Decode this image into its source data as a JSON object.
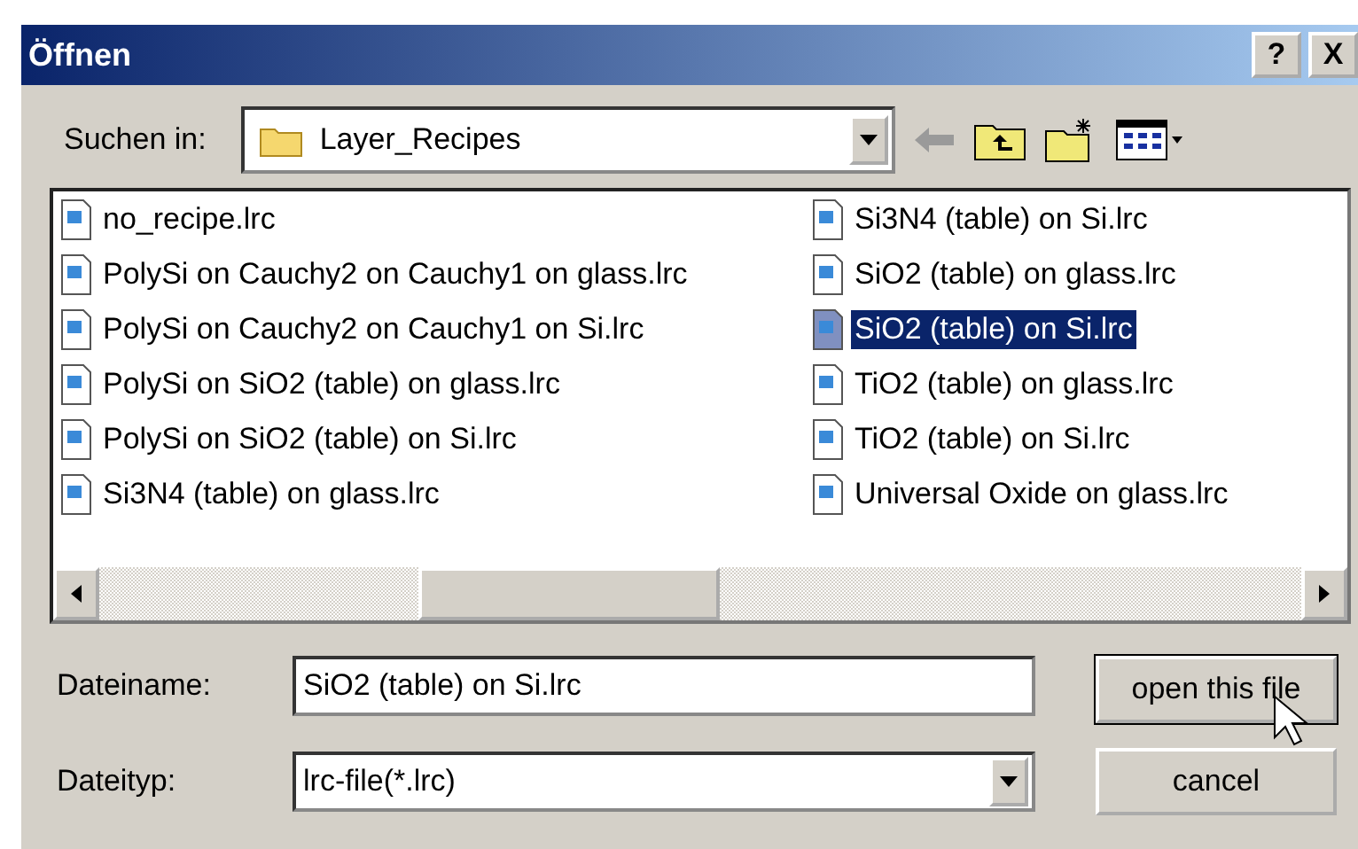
{
  "window": {
    "title": "Öffnen",
    "help_button": "?",
    "close_button": "X"
  },
  "look_in": {
    "label": "Suchen in:",
    "value": "Layer_Recipes"
  },
  "files": {
    "columns": [
      [
        {
          "name": "no_recipe.lrc",
          "selected": false
        },
        {
          "name": "PolySi on Cauchy2 on Cauchy1 on glass.lrc",
          "selected": false
        },
        {
          "name": "PolySi on Cauchy2 on Cauchy1 on Si.lrc",
          "selected": false
        },
        {
          "name": "PolySi on SiO2 (table) on glass.lrc",
          "selected": false
        },
        {
          "name": "PolySi on SiO2 (table) on Si.lrc",
          "selected": false
        },
        {
          "name": "Si3N4 (table) on glass.lrc",
          "selected": false
        }
      ],
      [
        {
          "name": "Si3N4 (table) on Si.lrc",
          "selected": false
        },
        {
          "name": "SiO2 (table) on glass.lrc",
          "selected": false
        },
        {
          "name": "SiO2 (table) on Si.lrc",
          "selected": true
        },
        {
          "name": "TiO2 (table) on glass.lrc",
          "selected": false
        },
        {
          "name": "TiO2 (table) on Si.lrc",
          "selected": false
        },
        {
          "name": "Universal Oxide on glass.lrc",
          "selected": false
        }
      ]
    ]
  },
  "file_name": {
    "label": "Dateiname:",
    "value": "SiO2 (table) on Si.lrc"
  },
  "file_type": {
    "label": "Dateityp:",
    "value": "lrc-file(*.lrc)"
  },
  "buttons": {
    "open": "open this file",
    "cancel": "cancel"
  }
}
